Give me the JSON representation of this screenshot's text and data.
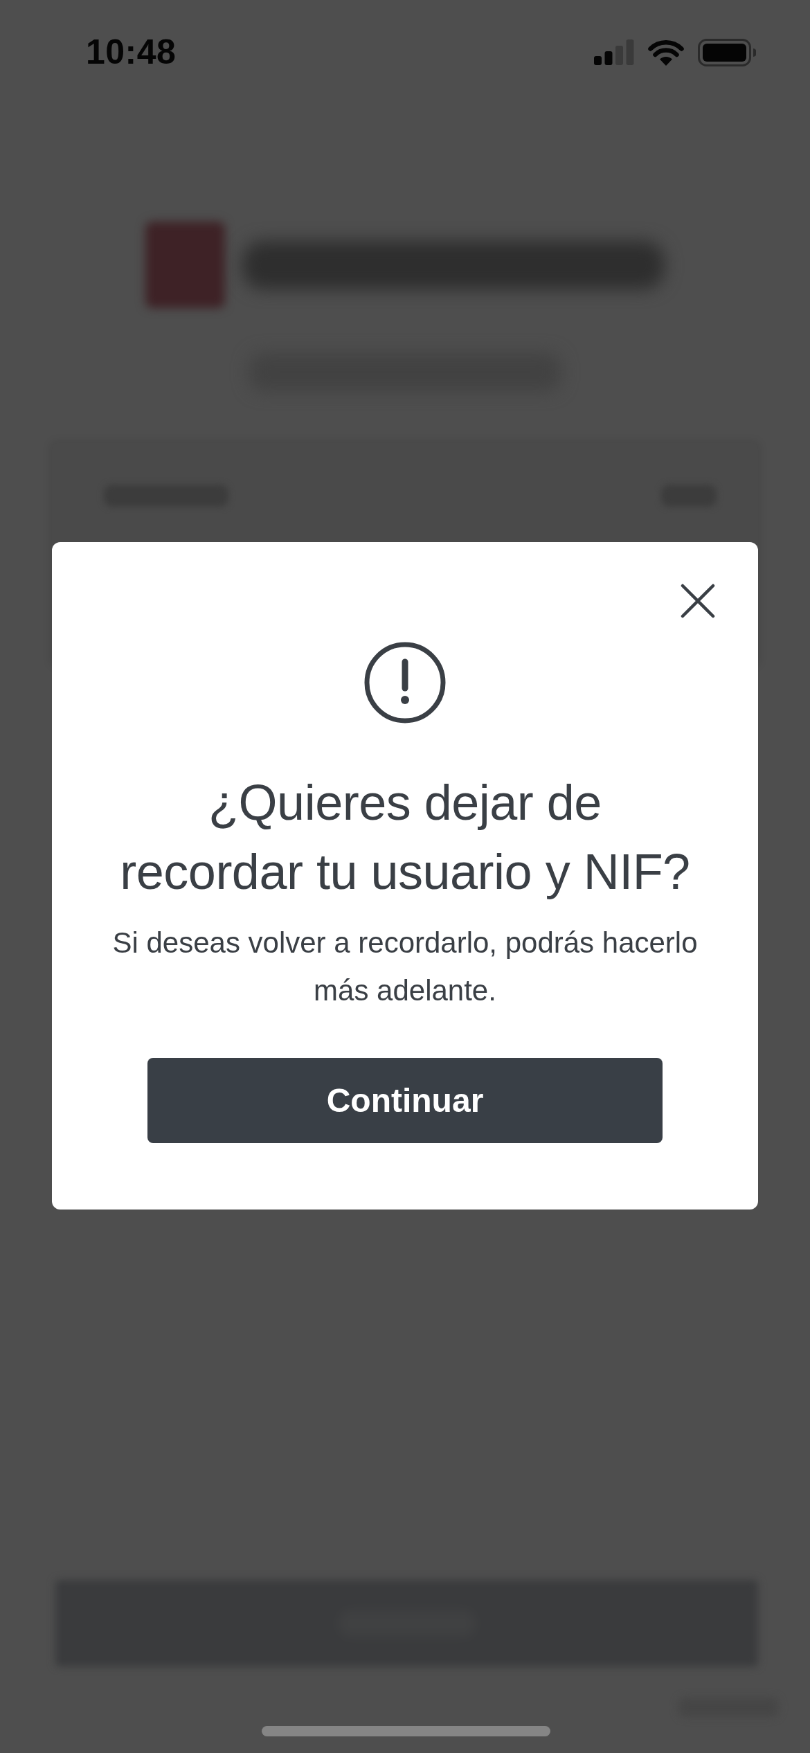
{
  "status_bar": {
    "time": "10:48"
  },
  "dialog": {
    "title": "¿Quieres dejar de\nrecordar tu usuario y NIF?",
    "message": "Si deseas volver a recordarlo, podrás hacerlo\nmás adelante.",
    "button": "Continuar"
  }
}
